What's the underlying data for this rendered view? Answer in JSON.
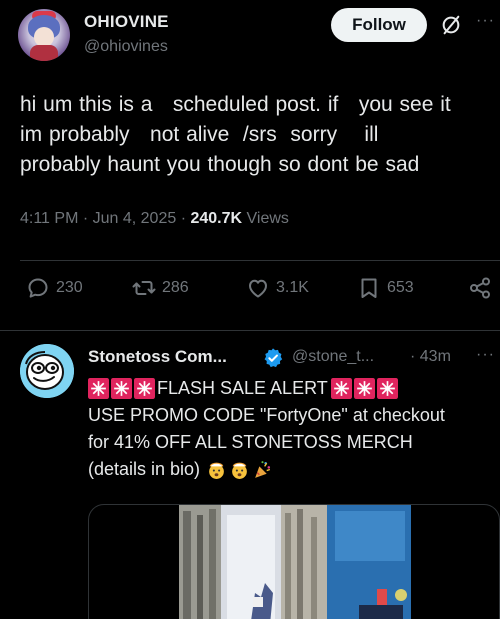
{
  "post": {
    "display_name": "OHIOVINE",
    "handle": "@ohiovines",
    "follow_label": "Follow",
    "more_glyph": "···",
    "text": "hi um this is a   scheduled post. if   you see it\nim probably   not alive  /srs  sorry    ill\nprobably haunt you though so dont be sad",
    "time": "4:11 PM · Jun 4, 2025 · ",
    "views_count": "240.7K",
    "views_label": " Views",
    "stats": {
      "replies": "230",
      "reposts": "286",
      "likes": "3.1K",
      "bookmarks": "653"
    }
  },
  "reply": {
    "display_name": "Stonetoss Com...",
    "handle": "@stone_t...",
    "time": "· 43m",
    "more_glyph": "···",
    "line1": "FLASH SALE ALERT",
    "line2": "USE PROMO CODE \"FortyOne\" at checkout",
    "line3": "for 41% OFF ALL STONETOSS MERCH",
    "line4": "(details in bio)"
  },
  "colors": {
    "background": "#000000",
    "text": "#e7e9ea",
    "muted": "#71767b",
    "divider": "#2f3336",
    "verified": "#1d9bf0",
    "siren_red": "#e0245e"
  }
}
